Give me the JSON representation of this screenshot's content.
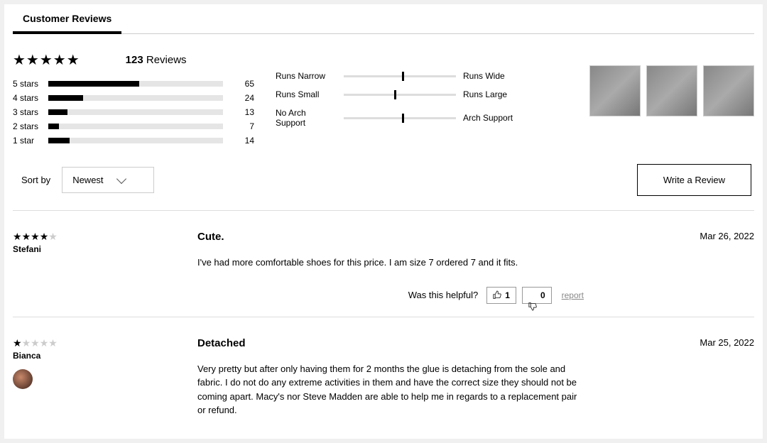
{
  "tabs": {
    "customer_reviews": "Customer Reviews"
  },
  "summary": {
    "overall_stars": 5,
    "review_count_num": "123",
    "review_count_word": "Reviews",
    "histogram": [
      {
        "label": "5 stars",
        "count": "65",
        "pct": 52
      },
      {
        "label": "4 stars",
        "count": "24",
        "pct": 20
      },
      {
        "label": "3 stars",
        "count": "13",
        "pct": 11
      },
      {
        "label": "2 stars",
        "count": "7",
        "pct": 6
      },
      {
        "label": "1 star",
        "count": "14",
        "pct": 12
      }
    ],
    "fit": [
      {
        "left": "Runs Narrow",
        "right": "Runs Wide",
        "pos": 52
      },
      {
        "left": "Runs Small",
        "right": "Runs Large",
        "pos": 45
      },
      {
        "left": "No Arch Support",
        "right": "Arch Support",
        "pos": 52
      }
    ]
  },
  "sort": {
    "label": "Sort by",
    "selected": "Newest"
  },
  "write_review": "Write a Review",
  "helpful_label": "Was this helpful?",
  "report_label": "report",
  "reviews": [
    {
      "stars": 4,
      "author": "Stefani",
      "title": "Cute.",
      "body": "I've had more comfortable shoes for this price. I am size 7 ordered 7 and it fits.",
      "date": "Mar 26, 2022",
      "up": "1",
      "down": "0",
      "has_avatar": false
    },
    {
      "stars": 1,
      "author": "Bianca",
      "title": "Detached",
      "body": "Very pretty but after only having them for 2 months the glue is detaching from the sole and fabric. I do not do any extreme activities in them and have the correct size they should not be coming apart. Macy's nor Steve Madden are able to help me in regards to a replacement pair or refund.",
      "date": "Mar 25, 2022",
      "up": "",
      "down": "",
      "has_avatar": true
    }
  ]
}
